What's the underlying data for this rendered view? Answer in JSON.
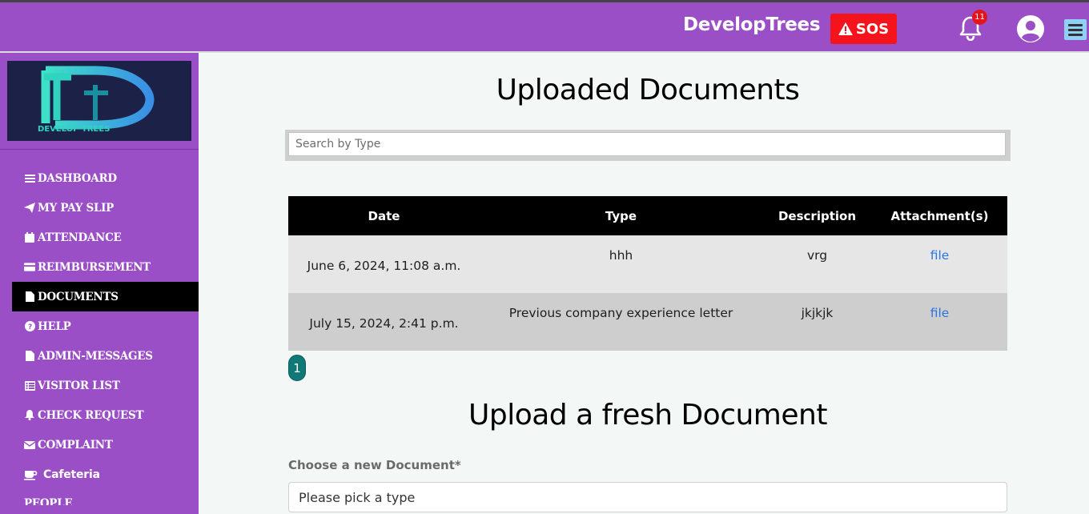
{
  "header": {
    "brand": "DevelopTrees",
    "sos_label": "SOS",
    "notification_count": "11"
  },
  "sidebar": {
    "logo_text": "DEVELOP TREES",
    "items": [
      {
        "label": "DASHBOARD",
        "icon": "bars-icon"
      },
      {
        "label": "MY PAY SLIP",
        "icon": "paper-plane-icon"
      },
      {
        "label": "ATTENDANCE",
        "icon": "calendar-icon"
      },
      {
        "label": "REIMBURSEMENT",
        "icon": "credit-card-icon"
      },
      {
        "label": "DOCUMENTS",
        "icon": "file-icon",
        "active": true
      },
      {
        "label": "HELP",
        "icon": "question-circle-icon"
      },
      {
        "label": "ADMIN-MESSAGES",
        "icon": "file-icon"
      },
      {
        "label": "VISITOR LIST",
        "icon": "list-icon"
      },
      {
        "label": "CHECK REQUEST",
        "icon": "bell-icon"
      },
      {
        "label": "COMPLAINT",
        "icon": "envelope-icon"
      },
      {
        "label": "Cafeteria",
        "icon": "coffee-icon"
      },
      {
        "label": "PEOPLE",
        "icon": ""
      }
    ]
  },
  "main": {
    "title": "Uploaded Documents",
    "search_placeholder": "Search by Type",
    "table": {
      "headers": [
        "Date",
        "Type",
        "Description",
        "Attachment(s)"
      ],
      "rows": [
        {
          "date": "June 6, 2024, 11:08 a.m.",
          "type": "hhh",
          "description": "vrg",
          "attachment": "file"
        },
        {
          "date": "July 15, 2024, 2:41 p.m.",
          "type": "Previous company experience letter",
          "description": "jkjkjk",
          "attachment": "file"
        }
      ]
    },
    "pagination": {
      "current": "1"
    },
    "upload_title": "Upload a fresh Document",
    "upload_label": "Choose a new Document*",
    "type_placeholder": "Please pick a type"
  },
  "colors": {
    "nav_bg": "#9b4fc6",
    "sos_red": "#f5141c",
    "link_blue": "#2876e6",
    "pagination_teal": "#117878",
    "active_bg": "#000000"
  }
}
